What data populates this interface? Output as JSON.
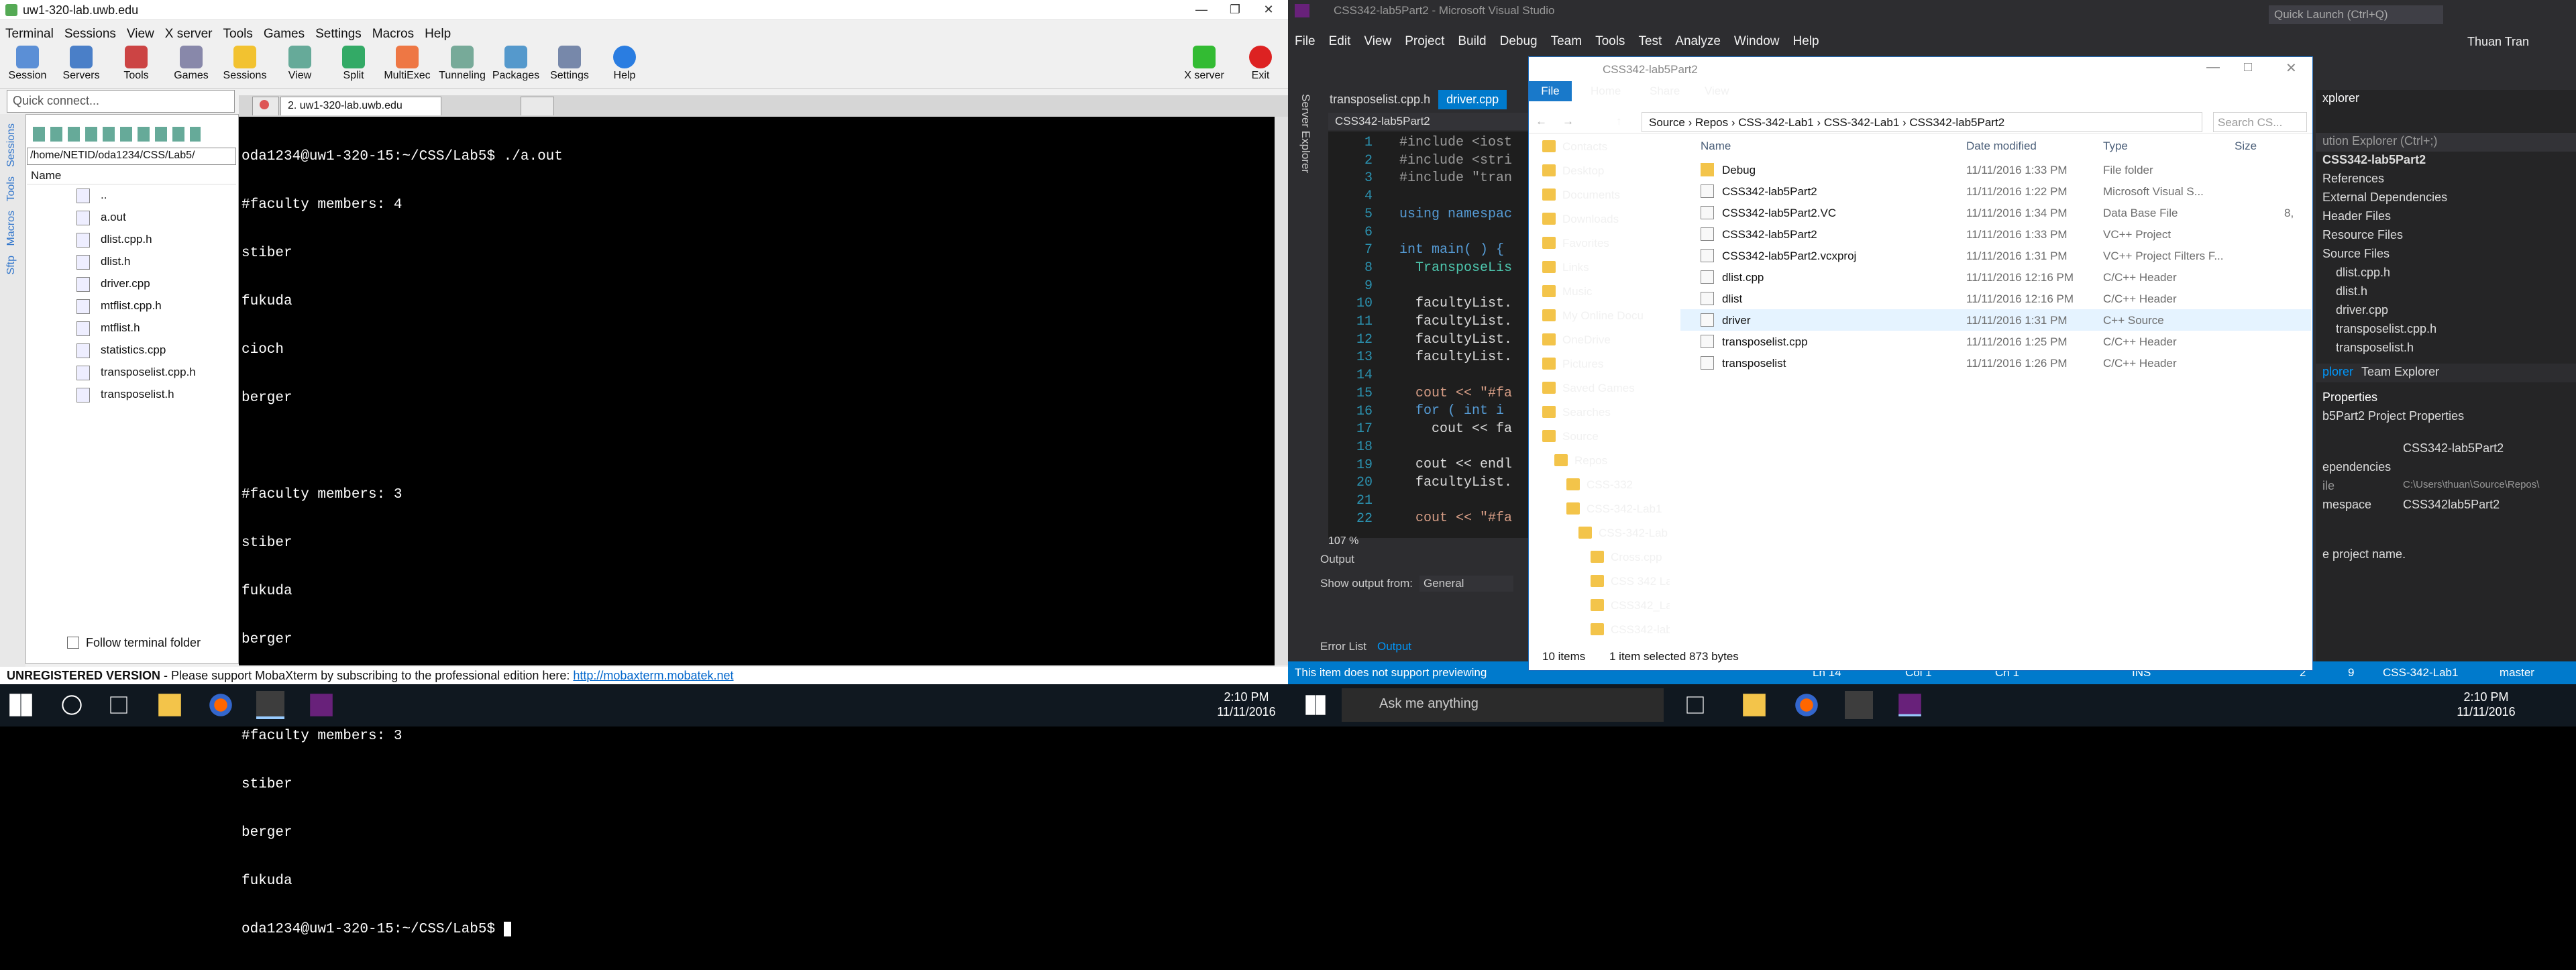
{
  "moba": {
    "title": "uw1-320-lab.uwb.edu",
    "menu": [
      "Terminal",
      "Sessions",
      "View",
      "X server",
      "Tools",
      "Games",
      "Settings",
      "Macros",
      "Help"
    ],
    "toolbar": [
      "Session",
      "Servers",
      "Tools",
      "Games",
      "Sessions",
      "View",
      "Split",
      "MultiExec",
      "Tunneling",
      "Packages",
      "Settings",
      "Help"
    ],
    "xserver_label": "X server",
    "exit_label": "Exit",
    "quick_connect": "Quick connect...",
    "side_tabs": [
      "Sessions",
      "Tools",
      "Macros",
      "Sftp"
    ],
    "path": "/home/NETID/oda1234/CSS/Lab5/",
    "file_header": "Name",
    "files": [
      "..",
      "a.out",
      "dlist.cpp.h",
      "dlist.h",
      "driver.cpp",
      "mtflist.cpp.h",
      "mtflist.h",
      "statistics.cpp",
      "transposelist.cpp.h",
      "transposelist.h"
    ],
    "follow_label": "Follow terminal folder",
    "tab_label": "2. uw1-320-lab.uwb.edu",
    "terminal_lines": [
      "oda1234@uw1-320-15:~/CSS/Lab5$ ./a.out",
      "#faculty members: 4",
      "stiber",
      "fukuda",
      "cioch",
      "berger",
      "",
      "#faculty members: 3",
      "stiber",
      "fukuda",
      "berger",
      "",
      "#faculty members: 3",
      "stiber",
      "berger",
      "fukuda",
      "oda1234@uw1-320-15:~/CSS/Lab5$ "
    ],
    "unregistered_bold": "UNREGISTERED VERSION",
    "unregistered_text": " -  Please support MobaXterm by subscribing to the professional edition here: ",
    "unregistered_link": "http://mobaxterm.mobatek.net"
  },
  "taskbar_left": {
    "time": "2:10 PM",
    "date": "11/11/2016"
  },
  "taskbar_right": {
    "time": "2:10 PM",
    "date": "11/11/2016",
    "search": "Ask me anything"
  },
  "vs": {
    "title": "CSS342-lab5Part2 - Microsoft Visual Studio",
    "menu": [
      "File",
      "Edit",
      "View",
      "Project",
      "Build",
      "Debug",
      "Team",
      "Tools",
      "Test",
      "Analyze",
      "Window",
      "Help"
    ],
    "quick_launch": "Quick Launch (Ctrl+Q)",
    "user": "Thuan Tran",
    "tabs": [
      "transposelist.cpp.h",
      "driver.cpp"
    ],
    "project_tab": "CSS342-lab5Part2",
    "server_explorer": "Server Explorer",
    "line_numbers": [
      "1",
      "2",
      "3",
      "4",
      "5",
      "6",
      "7",
      "8",
      "9",
      "10",
      "11",
      "12",
      "13",
      "14",
      "15",
      "16",
      "17",
      "18",
      "19",
      "20",
      "21",
      "22"
    ],
    "code_lines": [
      [
        "pp",
        "#include <iost"
      ],
      [
        "pp",
        "#include <stri"
      ],
      [
        "pp",
        "#include \"tran"
      ],
      [
        "",
        ""
      ],
      [
        "kw",
        "using namespac"
      ],
      [
        "",
        ""
      ],
      [
        "kw",
        "int main( ) {"
      ],
      [
        "ty",
        "  TransposeLis"
      ],
      [
        "",
        ""
      ],
      [
        "tx",
        "  facultyList."
      ],
      [
        "tx",
        "  facultyList."
      ],
      [
        "tx",
        "  facultyList."
      ],
      [
        "tx",
        "  facultyList."
      ],
      [
        "",
        ""
      ],
      [
        "st",
        "  cout << \"#fa"
      ],
      [
        "kw",
        "  for ( int i"
      ],
      [
        "tx",
        "    cout << fa"
      ],
      [
        "",
        ""
      ],
      [
        "tx",
        "  cout << endl"
      ],
      [
        "tx",
        "  facultyList."
      ],
      [
        "",
        ""
      ],
      [
        "st",
        "  cout << \"#fa"
      ]
    ],
    "zoom": "107 %",
    "output_title": "Output",
    "show_output_label": "Show output from:",
    "show_output_value": "General",
    "bottom_tabs": [
      "Error List",
      "Output"
    ],
    "sol_header": "xplorer",
    "sol_search": "ution Explorer (Ctrl+;)",
    "sol_items": [
      "CSS342-lab5Part2",
      "References",
      "External Dependencies",
      "Header Files",
      "Resource Files",
      "Source Files",
      "dlist.cpp.h",
      "dlist.h",
      "driver.cpp",
      "transposelist.cpp.h",
      "transposelist.h"
    ],
    "sol_tabs": [
      "plorer",
      "Team Explorer"
    ],
    "props_title": "b5Part2  Project Properties",
    "props": [
      [
        "",
        "CSS342-lab5Part2"
      ],
      [
        "ependencies",
        ""
      ],
      [
        "ile",
        "C:\\Users\\thuan\\Source\\Repos\\"
      ],
      [
        "mespace",
        "CSS342lab5Part2"
      ]
    ],
    "props_desc": "e project name.",
    "status": {
      "msg": "This item does not support previewing",
      "ln": "Ln 14",
      "col": "Col 1",
      "ch": "Ch 1",
      "ins": "INS",
      "up": "2",
      "pen": "9",
      "repo": "CSS-342-Lab1",
      "branch": "master"
    }
  },
  "explorer": {
    "title": "CSS342-lab5Part2",
    "ribbon": [
      "File",
      "Home",
      "Share",
      "View"
    ],
    "address": [
      "Source",
      "Repos",
      "CSS-342-Lab1",
      "CSS-342-Lab1",
      "CSS342-lab5Part2"
    ],
    "search": "Search CS...",
    "nav": [
      "Contacts",
      "Desktop",
      "Documents",
      "Downloads",
      "Favorites",
      "Links",
      "Music",
      "My Online Docu",
      "OneDrive",
      "Pictures",
      "Saved Games",
      "Searches",
      "Source",
      "Repos",
      "CSS-332",
      "CSS-342-Lab1",
      "CSS-342-Lab",
      "Cross.cpp",
      "CSS 342 La",
      "CSS342_La",
      "CSS342-lab"
    ],
    "columns": [
      "Name",
      "Date modified",
      "Type",
      "Size"
    ],
    "rows": [
      [
        "Debug",
        "11/11/2016 1:33 PM",
        "File folder",
        ""
      ],
      [
        "CSS342-lab5Part2",
        "11/11/2016 1:22 PM",
        "Microsoft Visual S...",
        ""
      ],
      [
        "CSS342-lab5Part2.VC",
        "11/11/2016 1:34 PM",
        "Data Base File",
        "8,"
      ],
      [
        "CSS342-lab5Part2",
        "11/11/2016 1:33 PM",
        "VC++ Project",
        ""
      ],
      [
        "CSS342-lab5Part2.vcxproj",
        "11/11/2016 1:31 PM",
        "VC++ Project Filters F...",
        ""
      ],
      [
        "dlist.cpp",
        "11/11/2016 12:16 PM",
        "C/C++ Header",
        ""
      ],
      [
        "dlist",
        "11/11/2016 12:16 PM",
        "C/C++ Header",
        ""
      ],
      [
        "driver",
        "11/11/2016 1:31 PM",
        "C++ Source",
        ""
      ],
      [
        "transposelist.cpp",
        "11/11/2016 1:25 PM",
        "C/C++ Header",
        ""
      ],
      [
        "transposelist",
        "11/11/2016 1:26 PM",
        "C/C++ Header",
        ""
      ]
    ],
    "selected_index": 7,
    "status_items": "10 items",
    "status_selected": "1 item selected  873 bytes"
  }
}
